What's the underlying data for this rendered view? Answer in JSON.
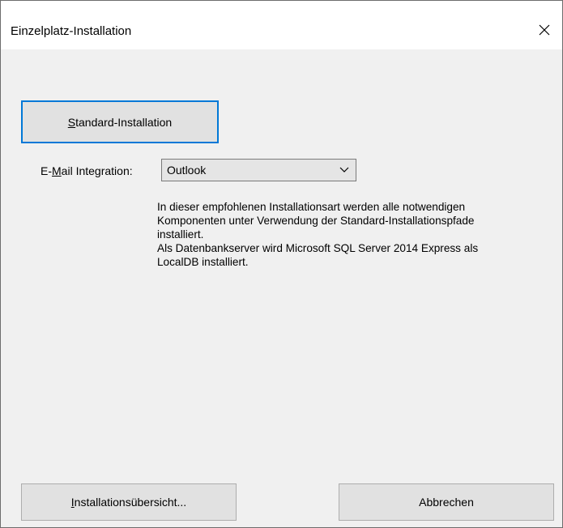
{
  "window": {
    "title": "Einzelplatz-Installation"
  },
  "icons": {
    "close": "close-icon",
    "dropdown": "chevron-down-icon"
  },
  "colors": {
    "default_button_border": "#0078d7",
    "button_face": "#e1e1e1",
    "dialog_background": "#f0f0f0"
  },
  "main": {
    "standard_button_mnemonic": "S",
    "standard_button_rest": "tandard-Installation",
    "email_label_pre": "E-",
    "email_label_mnemonic": "M",
    "email_label_post": "ail Integration:",
    "email_select_value": "Outlook",
    "description_lines": [
      "In dieser empfohlenen Installationsart werden alle notwendigen",
      "Komponenten unter Verwendung der Standard-Installationspfade",
      "installiert.",
      "Als Datenbankserver wird Microsoft SQL Server 2014 Express als",
      "LocalDB installiert."
    ]
  },
  "footer": {
    "overview_mnemonic": "I",
    "overview_rest": "nstallationsübersicht...",
    "cancel_label": "Abbrechen"
  }
}
